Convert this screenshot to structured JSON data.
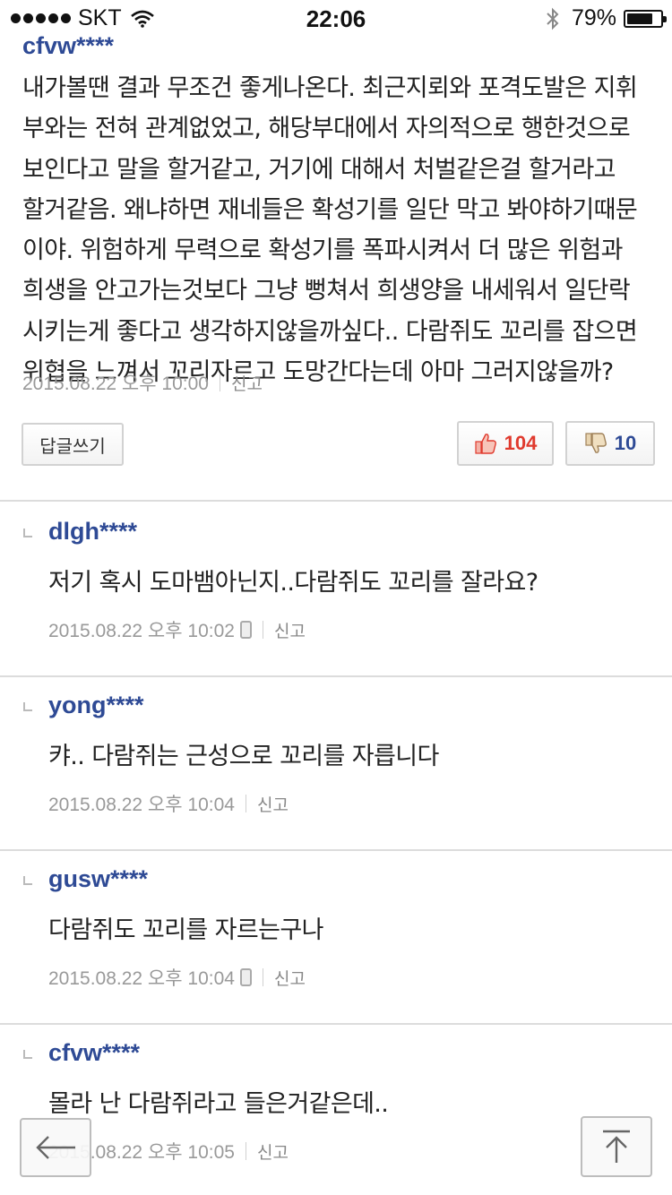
{
  "status_bar": {
    "carrier": "SKT",
    "time": "22:06",
    "battery": "79%",
    "battery_level": 0.79
  },
  "main_comment": {
    "author": "cfvw****",
    "body": "내가볼땐 결과 무조건 좋게나온다. 최근지뢰와 포격도발은 지휘부와는 전혀 관계없었고, 해당부대에서 자의적으로 행한것으로 보인다고 말을 할거같고, 거기에 대해서 처벌같은걸 할거라고 할거같음. 왜냐하면 재네들은 확성기를 일단 막고 봐야하기때문이야. 위험하게 무력으로 확성기를 폭파시켜서 더 많은 위험과 희생을 안고가는것보다 그냥 뻥쳐서 희생양을 내세워서 일단락시키는게 좋다고 생각하지않을까싶다.. 다람쥐도 꼬리를 잡으면 위협을 느껴서 꼬리자르고 도망간다는데 아마 그러지않을까?",
    "date": "2015.08.22 오후 10:00",
    "report": "신고",
    "reply_button": "답글쓰기",
    "likes": "104",
    "dislikes": "10"
  },
  "replies": [
    {
      "author": "dlgh****",
      "text": "저기 혹시 도마뱀아닌지..다람쥐도 꼬리를 잘라요?",
      "date": "2015.08.22 오후 10:02",
      "mobile": true,
      "report": "신고"
    },
    {
      "author": "yong****",
      "text": "캬.. 다람쥐는 근성으로 꼬리를 자릅니다",
      "date": "2015.08.22 오후 10:04",
      "mobile": false,
      "report": "신고"
    },
    {
      "author": "gusw****",
      "text": "다람쥐도 꼬리를 자르는구나",
      "date": "2015.08.22 오후 10:04",
      "mobile": true,
      "report": "신고"
    },
    {
      "author": "cfvw****",
      "text": "몰라 난 다람쥐라고 들은거같은데..",
      "date": "2015.08.22 오후 10:05",
      "mobile": false,
      "report": "신고"
    }
  ],
  "colors": {
    "author": "#2e4a95",
    "like": "#e03a2e",
    "dislike": "#2e4a95",
    "meta": "#999999",
    "divider": "#dcdcdc"
  },
  "icons": {
    "like": "thumbs-up-icon",
    "dislike": "thumbs-down-icon",
    "back": "arrow-left-icon",
    "top": "arrow-up-to-top-icon",
    "mobile": "phone-icon"
  }
}
